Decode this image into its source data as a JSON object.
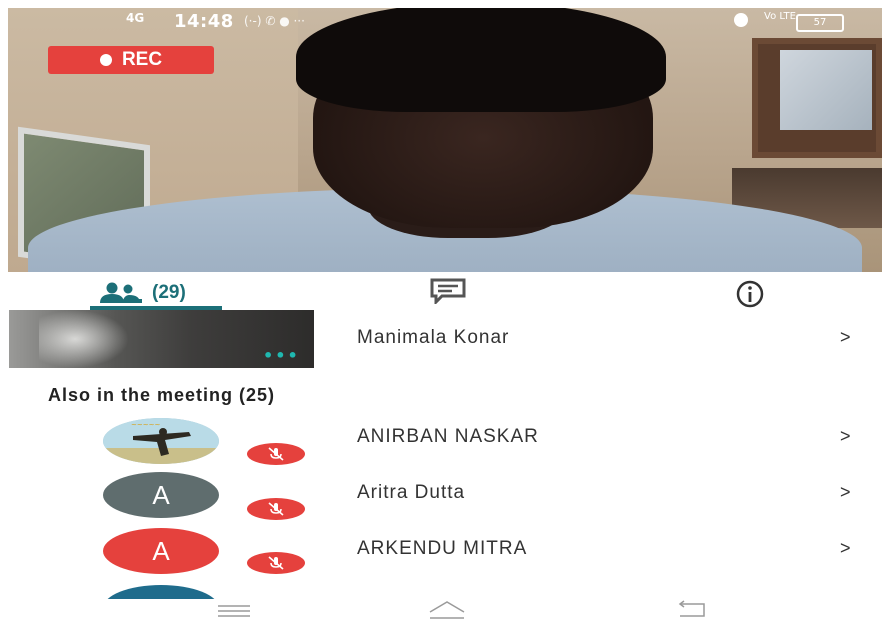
{
  "status_bar": {
    "network": "4G",
    "time": "14:48",
    "extra": "(·-)  ✆  ●  ···",
    "volte": "Vo LTE",
    "battery": "57"
  },
  "video": {
    "rec_label": "REC"
  },
  "tabs": {
    "participants_count": "(29)",
    "chat_icon": "chat-icon",
    "info_icon": "info-icon"
  },
  "active_speaker": {
    "name": "Manimala Konar",
    "chevron": ">"
  },
  "also_in_meeting": {
    "heading": "Also in the meeting (25)",
    "participants": [
      {
        "name": "ANIRBAN NASKAR",
        "avatar_letter": "",
        "avatar_type": "photo",
        "muted": true,
        "chevron": ">"
      },
      {
        "name": "Aritra Dutta",
        "avatar_letter": "A",
        "avatar_color": "#5f6d6e",
        "muted": true,
        "chevron": ">"
      },
      {
        "name": "ARKENDU MITRA",
        "avatar_letter": "A",
        "avatar_color": "#e5413d",
        "muted": true,
        "chevron": ">"
      }
    ]
  },
  "colors": {
    "accent": "#1c6f78",
    "rec_red": "#e5413d",
    "avatar_teal": "#1f6c8c"
  },
  "nav_bar": {
    "icons": [
      "menu-icon",
      "home-icon",
      "back-icon"
    ]
  }
}
